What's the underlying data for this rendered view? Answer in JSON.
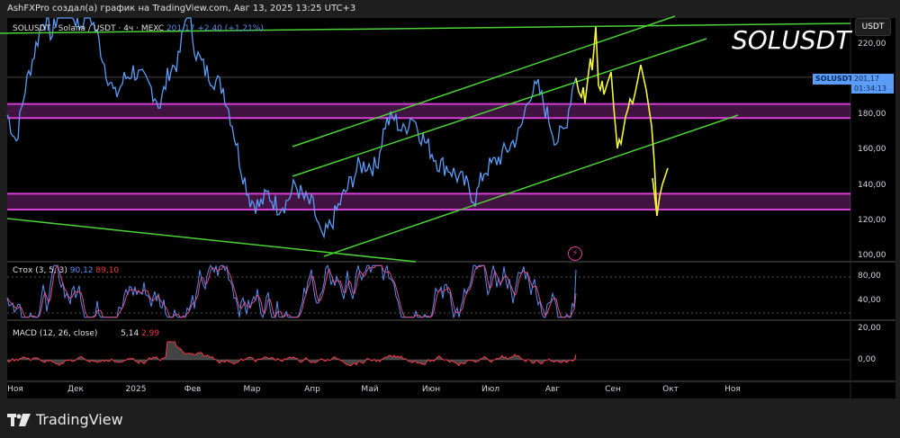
{
  "header": {
    "caption": "AshFXPro создал(а) график на TradingView.com, Авг 13, 2025 13:25 UTC+3"
  },
  "legend": {
    "symbol": "SOLUSDT · Solana / USDT · 4ч · MEXC",
    "price": "201,17",
    "change": "+2,40 (+1,21%)"
  },
  "watermark": "SOLUSDT",
  "price_axis": {
    "currency": "USDT",
    "labels": [
      "220,00",
      "180,00",
      "160,00",
      "140,00",
      "120,00",
      "100,00"
    ],
    "current_symbol": "SOLUSDT",
    "current_price": "201,17",
    "countdown": "01:34:13"
  },
  "stoch": {
    "title": "Стох (3, 5, 3)",
    "k": "90,12",
    "d": "89,10",
    "labels": [
      "80,00",
      "40,00"
    ]
  },
  "macd": {
    "title": "MACD (12, 26, close)",
    "macd": "5,14",
    "signal": "2,99",
    "labels": [
      "20,00",
      "0,00"
    ]
  },
  "time_axis": [
    "Ноя",
    "Дек",
    "2025",
    "Фев",
    "Мар",
    "Апр",
    "Май",
    "Июн",
    "Июл",
    "Авг",
    "Сен",
    "Окт",
    "Ноя"
  ],
  "price_series": [
    180,
    165,
    195,
    215,
    235,
    225,
    245,
    240,
    230,
    240,
    225,
    205,
    190,
    200,
    205,
    200,
    195,
    185,
    205,
    210,
    240,
    215,
    205,
    200,
    195,
    175,
    150,
    132,
    128,
    135,
    128,
    130,
    140,
    132,
    128,
    108,
    118,
    130,
    140,
    150,
    152,
    150,
    175,
    178,
    170,
    180,
    168,
    160,
    152,
    150,
    145,
    140,
    132,
    148,
    152,
    157,
    163,
    170,
    192,
    195,
    180,
    165,
    172,
    201
  ],
  "zones": [
    [
      178,
      186
    ],
    [
      126,
      135
    ]
  ],
  "colors": {
    "price": "#5b9cf6",
    "trendline": "#4cd137",
    "zone": "#d63fd6",
    "projection": "#f5f53a",
    "stoch_k": "#5b8def",
    "stoch_d": "#f23645"
  },
  "footer": {
    "brand": "TradingView"
  }
}
